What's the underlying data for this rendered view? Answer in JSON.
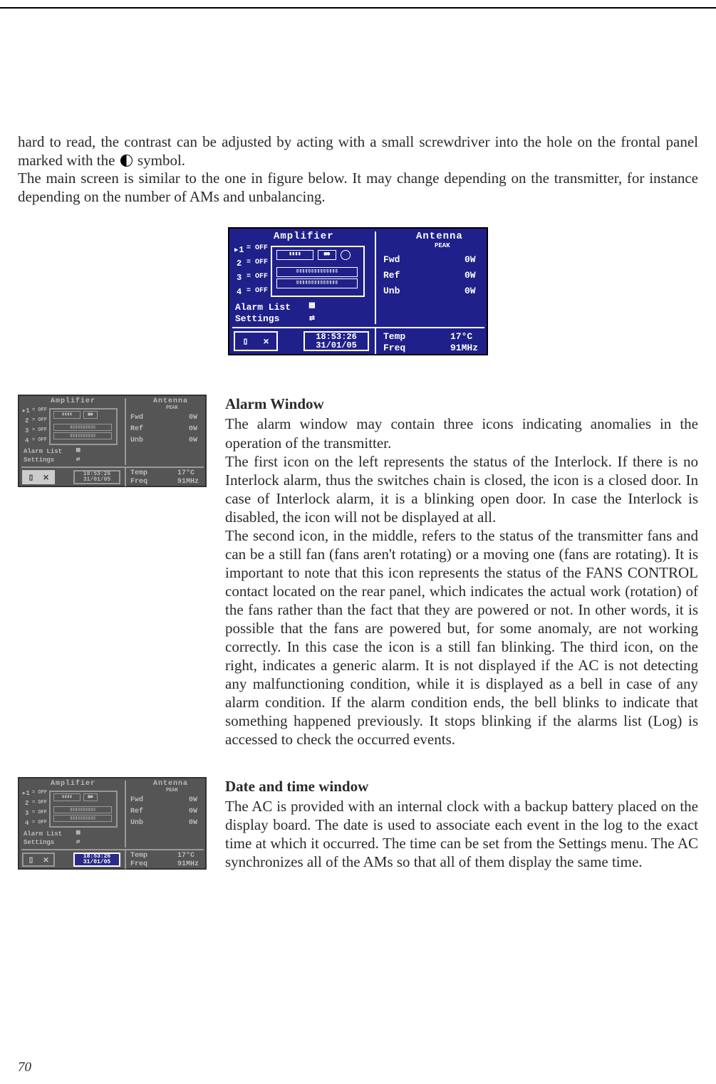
{
  "intro": {
    "p1_a": "hard to read, the contrast can be adjusted by acting with a small screwdriver into the hole on the frontal panel marked with the",
    "p1_b": "symbol.",
    "p2": "The main screen is similar to the one in figure below. It may change depending on the transmitter, for instance depending on the number of AMs and unbalancing."
  },
  "lcd": {
    "amplifier_label": "Amplifier",
    "antenna_label": "Antenna",
    "antenna_sub": "PEAK",
    "rows": [
      "1",
      "2",
      "3",
      "4"
    ],
    "off": "= OFF",
    "fwd_label": "Fwd",
    "fwd_val": "0W",
    "ref_label": "Ref",
    "ref_val": "0W",
    "unb_label": "Unb",
    "unb_val": "0W",
    "alarm_list": "Alarm List",
    "settings": "Settings",
    "time": "18:53:26",
    "date": "31/01/05",
    "temp_label": "Temp",
    "temp_val": "17°C",
    "freq_label": "Freq",
    "freq_val": "91MHz",
    "door_icon": "▯",
    "fan_icon": "✕"
  },
  "sections": {
    "alarm": {
      "heading": "Alarm Window",
      "body": "The alarm window may contain three icons indicating anomalies in the operation of the transmitter.\nThe first icon on the left represents the status of the Interlock. If there is no Interlock alarm, thus the switches chain is closed, the icon is a closed door. In case of Interlock alarm, it is a blinking open door. In case the Interlock is disabled, the icon will not be displayed at all.\nThe second icon, in the middle, refers to the status of the transmitter fans and can be a still fan (fans aren't rotating) or a moving one (fans are rotating). It is important to note that this icon represents the status of the FANS CONTROL contact located on the rear panel, which indicates the actual work (rotation) of the fans rather than the fact that they are powered or not. In other words, it is possible that the fans are powered but, for some anomaly, are not working correctly. In this case the icon is a still fan blinking. The third icon, on the right, indicates a generic alarm. It is not displayed if the AC is not detecting any malfunctioning condition, while it is displayed as a bell in case of any alarm condition. If the alarm condition ends, the bell blinks to indicate that something happened previously. It stops blinking if the alarms list (Log) is accessed to check the occurred events."
    },
    "datetime": {
      "heading": "Date and time window",
      "body": "The AC is provided with an internal clock with a backup battery placed on the display board. The date is used to associate each event in the log to the exact time at which it occurred. The time can be set from the Settings menu. The AC synchronizes all of the AMs so that all of them display the same time."
    }
  },
  "page_number": "70"
}
